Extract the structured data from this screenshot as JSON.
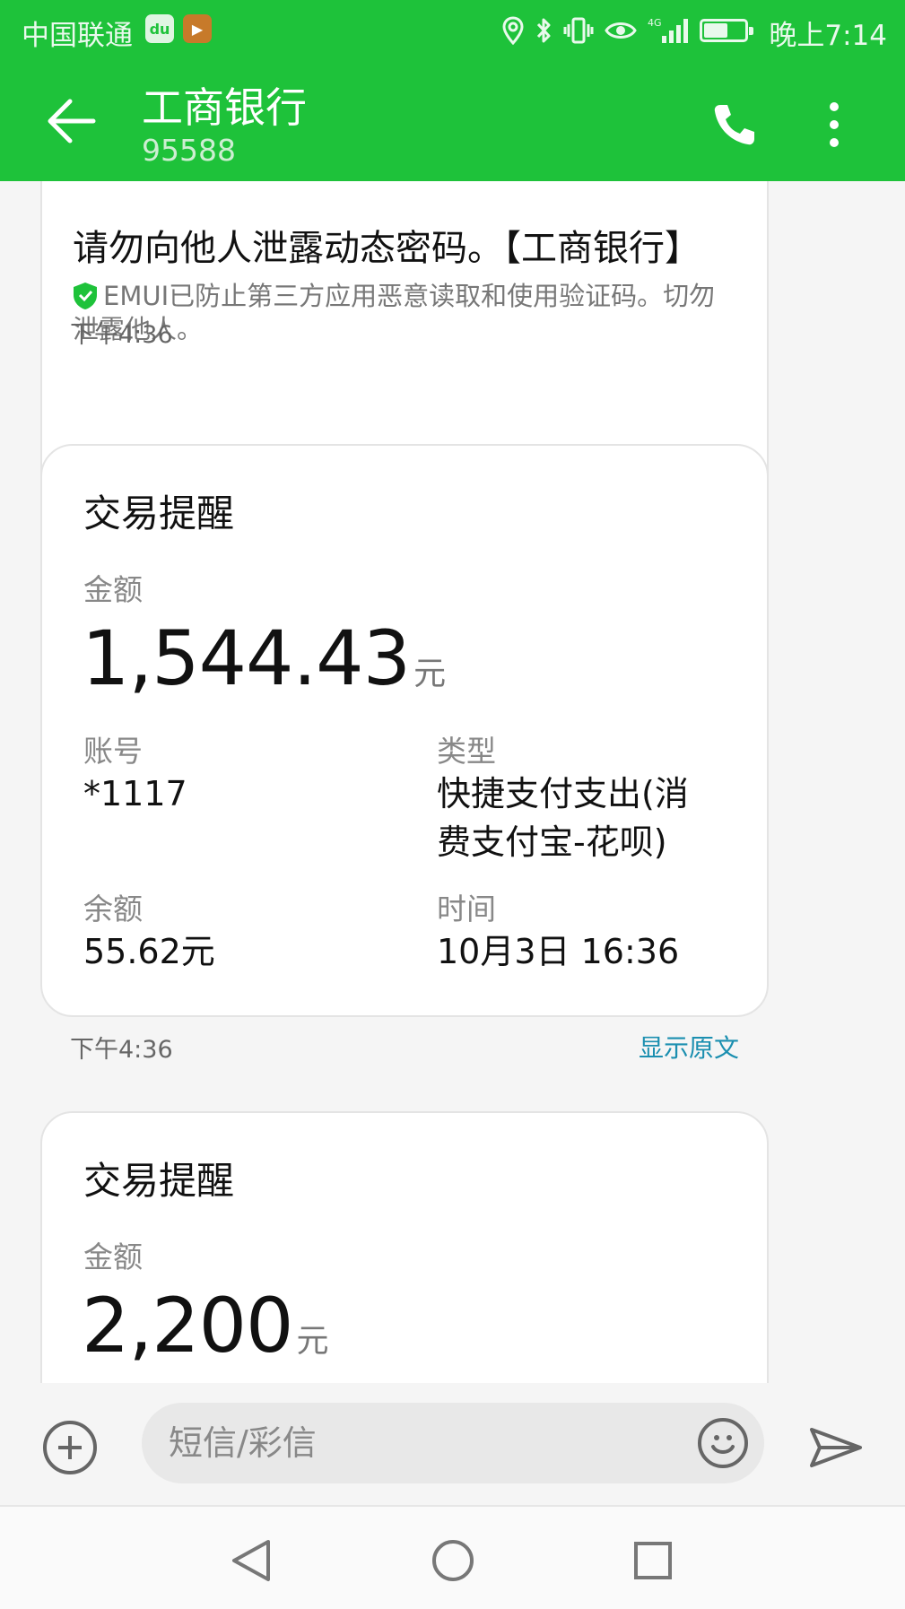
{
  "statusbar": {
    "carrier": "中国联通",
    "badge_du": "du",
    "badge_play": "▶",
    "network": "4G",
    "battery_level": 0.55,
    "clock": "晚上7:14"
  },
  "toolbar": {
    "title": "工商银行",
    "subtitle": "95588"
  },
  "messages": {
    "otp": {
      "body": "请勿向他人泄露动态密码。【工商银行】",
      "notice": "EMUI已防止第三方应用恶意读取和使用验证码。切勿泄露他人。",
      "time": "下午4:36"
    },
    "txn1": {
      "title": "交易提醒",
      "amount_label": "金额",
      "amount": "1,544.43",
      "unit": "元",
      "account_label": "账号",
      "account": "*1117",
      "type_label": "类型",
      "type_line1": "快捷支付支出(消",
      "type_line2": "费支付宝-花呗)",
      "balance_label": "余额",
      "balance": "55.62元",
      "time_label": "时间",
      "time_value": "10月3日 16:36",
      "time": "下午4:36",
      "show_original": "显示原文"
    },
    "txn2": {
      "title": "交易提醒",
      "amount_label": "金额",
      "amount": "2,200",
      "unit": "元"
    }
  },
  "composer": {
    "placeholder": "短信/彩信"
  },
  "colors": {
    "header": "#1ec23a",
    "link": "#1b8fb0",
    "shield": "#1ec23a"
  }
}
